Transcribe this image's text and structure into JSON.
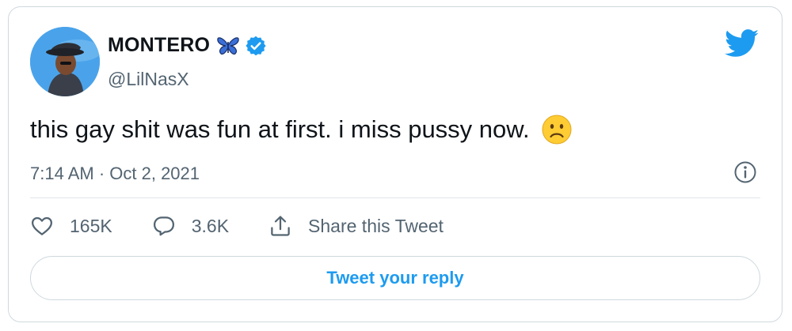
{
  "tweet": {
    "author": {
      "display_name": "MONTERO",
      "handle": "@LilNasX",
      "badges": [
        "butterfly-icon",
        "verified-icon"
      ]
    },
    "text": "this gay shit was fun at first. i miss pussy now.",
    "emoji": "sad-face-icon",
    "timestamp": "7:14 AM · Oct 2, 2021",
    "likes": "165K",
    "replies": "3.6K",
    "share_label": "Share this Tweet",
    "reply_button_label": "Tweet your reply"
  },
  "colors": {
    "brand": "#1d9bf0",
    "muted": "#536471",
    "border": "#cfd9de",
    "avatar_bg": "#4aa3ea"
  }
}
